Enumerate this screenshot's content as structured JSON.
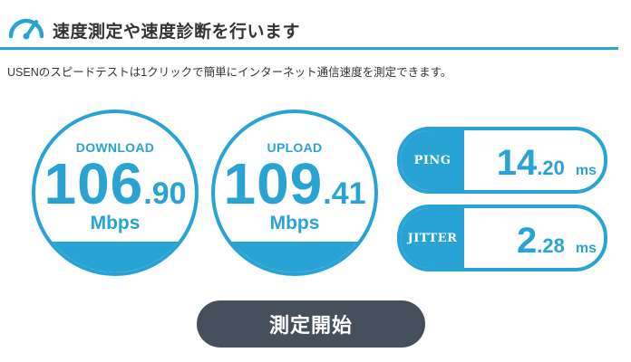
{
  "header": {
    "title": "速度測定や速度診断を行います",
    "icon": "speedometer-icon"
  },
  "description": "USENのスピードテストは1クリックで簡単にインターネット通信速度を測定できます。",
  "download": {
    "label": "DOWNLOAD",
    "integer": "106",
    "decimal": ".90",
    "unit": "Mbps"
  },
  "upload": {
    "label": "UPLOAD",
    "integer": "109",
    "decimal": ".41",
    "unit": "Mbps"
  },
  "ping": {
    "label": "PING",
    "integer": "14",
    "decimal": ".20",
    "unit": "ms"
  },
  "jitter": {
    "label": "JITTER",
    "integer": "2",
    "decimal": ".28",
    "unit": "ms"
  },
  "start_button": {
    "label": "測定開始"
  },
  "colors": {
    "accent": "#29a3d4",
    "button": "#46505c",
    "text": "#333333"
  }
}
